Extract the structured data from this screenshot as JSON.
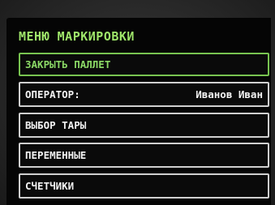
{
  "menu": {
    "title": "МЕНЮ МАРКИРОВКИ",
    "items": [
      {
        "label": "ЗАКРЫТЬ ПАЛЛЕТ",
        "selected": true
      },
      {
        "label": "ОПЕРАТОР:",
        "value": "Иванов Иван"
      },
      {
        "label": "ВЫБОР ТАРЫ"
      },
      {
        "label": "ПЕРЕМЕННЫЕ"
      },
      {
        "label": "СЧЕТЧИКИ"
      }
    ]
  },
  "colors": {
    "selected_text": "#8bd866",
    "title_text": "#9fe66a",
    "item_text": "#f2f2f2",
    "item_border": "#cfcfcf",
    "screen_background": "#050505"
  }
}
